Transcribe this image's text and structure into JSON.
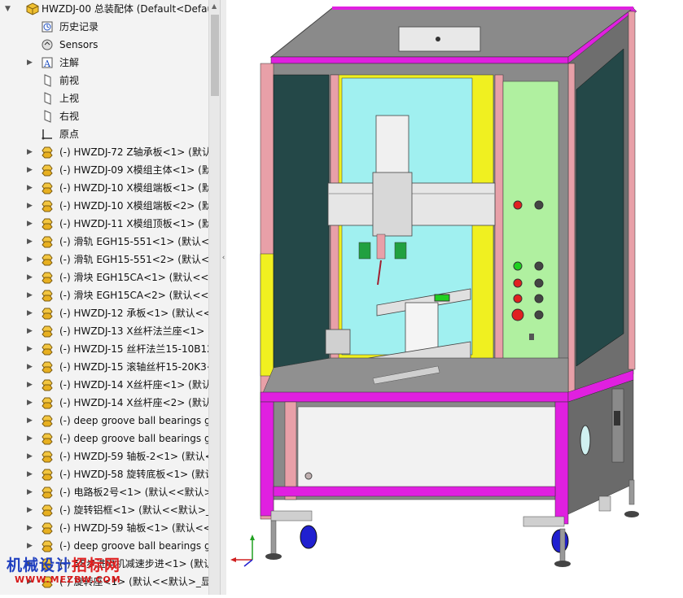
{
  "feature_tree": {
    "root": {
      "label": "HWZDJ-00 总装配体  (Default<Defau"
    },
    "items": [
      {
        "label": "历史记录",
        "icon": "history-icon",
        "expandable": false
      },
      {
        "label": "Sensors",
        "icon": "sensor-icon",
        "expandable": false
      },
      {
        "label": "注解",
        "icon": "annotation-icon",
        "expandable": true
      },
      {
        "label": "前视",
        "icon": "plane-icon",
        "expandable": false
      },
      {
        "label": "上视",
        "icon": "plane-icon",
        "expandable": false
      },
      {
        "label": "右视",
        "icon": "plane-icon",
        "expandable": false
      },
      {
        "label": "原点",
        "icon": "origin-icon",
        "expandable": false
      },
      {
        "label": "(-) HWZDJ-72 Z轴承板<1> (默认",
        "icon": "part-icon",
        "expandable": true
      },
      {
        "label": "(-) HWZDJ-09 X模组主体<1> (默",
        "icon": "part-icon",
        "expandable": true
      },
      {
        "label": "(-) HWZDJ-10 X模组端板<1> (默",
        "icon": "part-icon",
        "expandable": true
      },
      {
        "label": "(-) HWZDJ-10 X模组端板<2> (默",
        "icon": "part-icon",
        "expandable": true
      },
      {
        "label": "(-) HWZDJ-11 X模组顶板<1> (默",
        "icon": "part-icon",
        "expandable": true
      },
      {
        "label": "(-) 滑轨 EGH15-551<1> (默认<<",
        "icon": "part-icon",
        "expandable": true
      },
      {
        "label": "(-) 滑轨 EGH15-551<2> (默认<<",
        "icon": "part-icon",
        "expandable": true
      },
      {
        "label": "(-) 滑块 EGH15CA<1> (默认<<默",
        "icon": "part-icon",
        "expandable": true
      },
      {
        "label": "(-) 滑块 EGH15CA<2> (默认<<默",
        "icon": "part-icon",
        "expandable": true
      },
      {
        "label": "(-) HWZDJ-12 承板<1> (默认<<",
        "icon": "part-icon",
        "expandable": true
      },
      {
        "label": "(-) HWZDJ-13 X丝杆法兰座<1> (",
        "icon": "part-icon",
        "expandable": true
      },
      {
        "label": "(-) HWZDJ-15 丝杆法兰15-10B12",
        "icon": "part-icon",
        "expandable": true
      },
      {
        "label": "(-) HWZDJ-15 滚轴丝杆15-20K3<",
        "icon": "part-icon",
        "expandable": true
      },
      {
        "label": "(-) HWZDJ-14 X丝杆座<1> (默认",
        "icon": "part-icon",
        "expandable": true
      },
      {
        "label": "(-) HWZDJ-14 X丝杆座<2> (默认",
        "icon": "part-icon",
        "expandable": true
      },
      {
        "label": "(-) deep groove ball bearings g",
        "icon": "part-icon",
        "expandable": true
      },
      {
        "label": "(-) deep groove ball bearings g",
        "icon": "part-icon",
        "expandable": true
      },
      {
        "label": "(-) HWZDJ-59 轴板-2<1> (默认<",
        "icon": "part-icon",
        "expandable": true
      },
      {
        "label": "(-) HWZDJ-58 旋转底板<1> (默认",
        "icon": "part-icon",
        "expandable": true
      },
      {
        "label": "(-) 电路板2号<1> (默认<<默认>_",
        "icon": "part-icon",
        "expandable": true
      },
      {
        "label": "(-) 旋转铝框<1> (默认<<默认>_显",
        "icon": "part-icon",
        "expandable": true
      },
      {
        "label": "(-) HWZDJ-59 轴板<1> (默认<<默",
        "icon": "part-icon",
        "expandable": true
      },
      {
        "label": "(-) deep groove ball bearings g",
        "icon": "part-icon",
        "expandable": true
      },
      {
        "label": "(-) 58步进电机减速步进<1> (默认<<默",
        "icon": "part-icon",
        "expandable": true
      },
      {
        "label": "(-) 旋转座<1> (默认<<默认>_显",
        "icon": "part-icon",
        "expandable": true
      }
    ]
  },
  "watermark": {
    "text_a": "机械设计",
    "text_b": "招标网",
    "url": "WWW.MEZBW.COM"
  },
  "colors": {
    "frame_pink": "#e8a0a8",
    "frame_magenta": "#e020e0",
    "panel_cyan": "#a0f0f0",
    "panel_green": "#b0f0a0",
    "panel_yellow": "#f0f020",
    "glass_dark": "#2a5050",
    "gray": "#808080"
  }
}
